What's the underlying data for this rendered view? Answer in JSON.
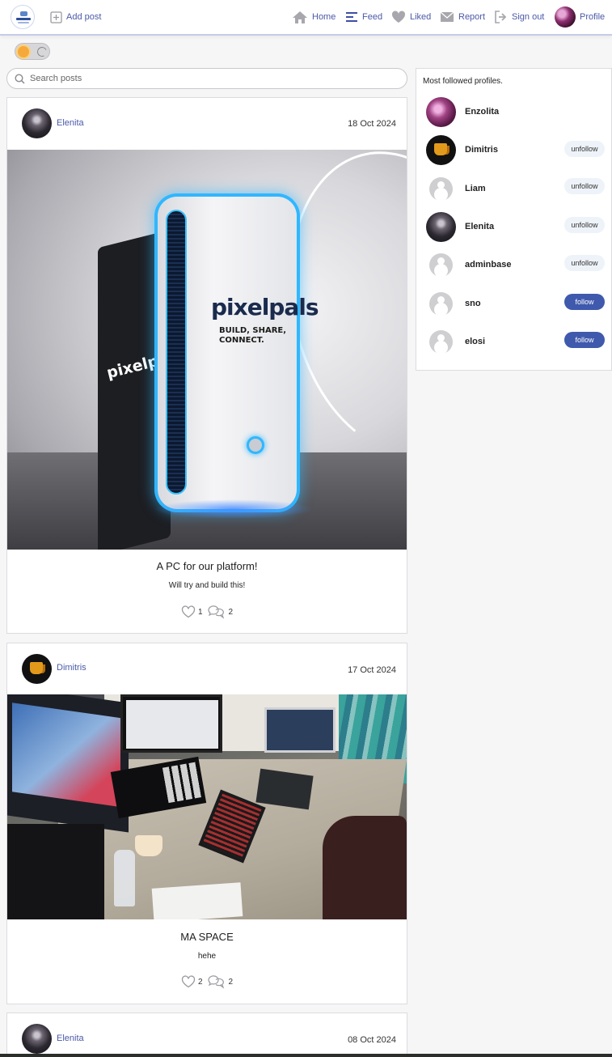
{
  "nav": {
    "add_post": "Add post",
    "home": "Home",
    "feed": "Feed",
    "liked": "Liked",
    "report": "Report",
    "sign_out": "Sign out",
    "profile": "Profile"
  },
  "search": {
    "placeholder": "Search posts"
  },
  "posts": [
    {
      "author": "Elenita",
      "date": "18 Oct 2024",
      "image_text": {
        "brand": "pixelpals",
        "tagline": "BUILD, SHARE, CONNECT.",
        "side_brand": "pixelpals"
      },
      "title": "A PC for our platform!",
      "body": "Will try and build this!",
      "likes": "1",
      "comments": "2"
    },
    {
      "author": "Dimitris",
      "date": "17 Oct 2024",
      "title": "MA SPACE",
      "body": "hehe",
      "likes": "2",
      "comments": "2"
    },
    {
      "author": "Elenita",
      "date": "08 Oct 2024"
    }
  ],
  "sidebar": {
    "title": "Most followed profiles.",
    "profiles": [
      {
        "name": "Enzolita",
        "action": ""
      },
      {
        "name": "Dimitris",
        "action": "unfollow"
      },
      {
        "name": "Liam",
        "action": "unfollow"
      },
      {
        "name": "Elenita",
        "action": "unfollow"
      },
      {
        "name": "adminbase",
        "action": "unfollow"
      },
      {
        "name": "sno",
        "action": "follow"
      },
      {
        "name": "elosi",
        "action": "follow"
      }
    ]
  },
  "colors": {
    "accent": "#4a5aa8",
    "follow_button": "#3f59ad",
    "unfollow_button": "#eef3f9"
  }
}
